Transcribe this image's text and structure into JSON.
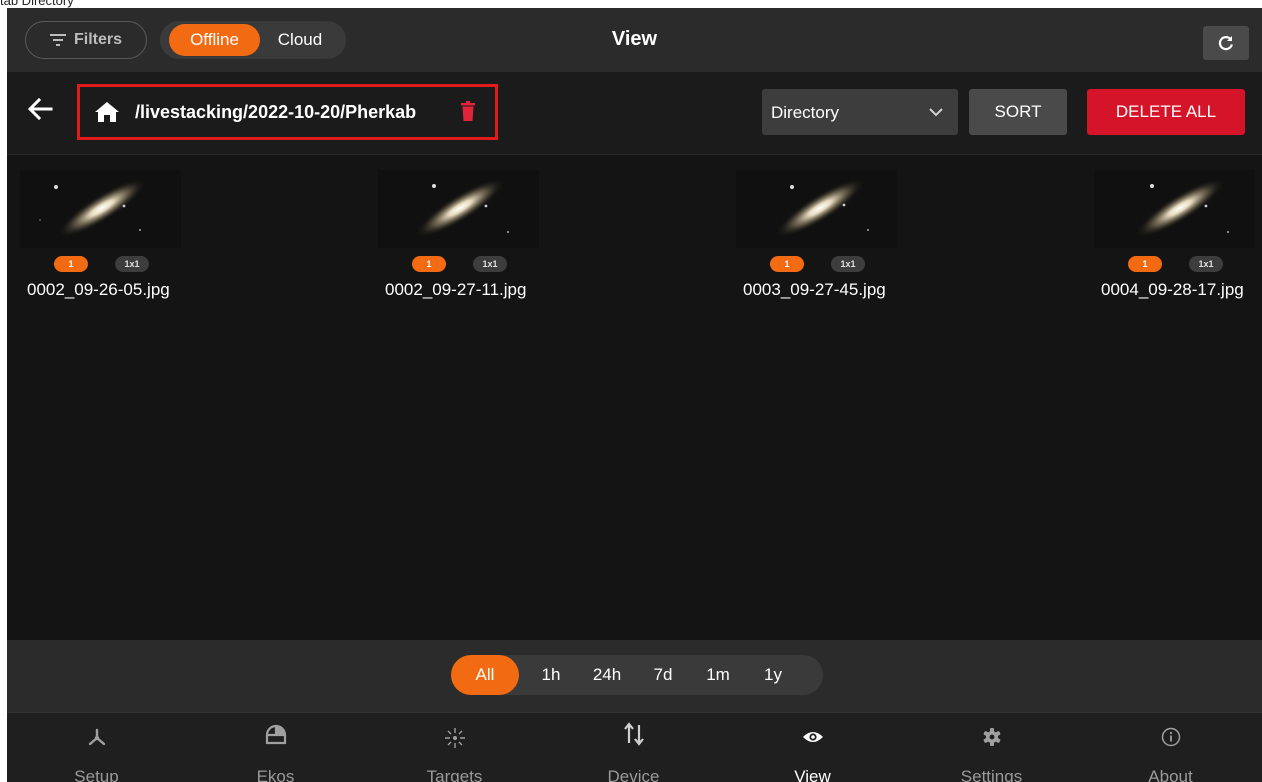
{
  "top_label": "tab Directory",
  "header": {
    "filters_label": "Filters",
    "segment": {
      "offline": "Offline",
      "cloud": "Cloud",
      "active": "Offline"
    },
    "title": "View"
  },
  "pathbar": {
    "path": "/livestacking/2022-10-20/Pherkab",
    "sort_select": "Directory",
    "sort_button": "SORT",
    "delete_all_button": "DELETE ALL"
  },
  "files": [
    {
      "name": "0002_09-26-05.jpg",
      "count": "1",
      "binning": "1x1"
    },
    {
      "name": "0002_09-27-11.jpg",
      "count": "1",
      "binning": "1x1"
    },
    {
      "name": "0003_09-27-45.jpg",
      "count": "1",
      "binning": "1x1"
    },
    {
      "name": "0004_09-28-17.jpg",
      "count": "1",
      "binning": "1x1"
    }
  ],
  "time_filters": {
    "options": [
      "All",
      "1h",
      "24h",
      "7d",
      "1m",
      "1y"
    ],
    "active": "All"
  },
  "nav": {
    "items": [
      {
        "label": "Setup",
        "icon": "setup-icon"
      },
      {
        "label": "Ekos",
        "icon": "ekos-icon"
      },
      {
        "label": "Targets",
        "icon": "targets-icon"
      },
      {
        "label": "Device",
        "icon": "device-icon"
      },
      {
        "label": "View",
        "icon": "eye-icon"
      },
      {
        "label": "Settings",
        "icon": "gear-icon"
      },
      {
        "label": "About",
        "icon": "info-icon"
      }
    ],
    "active": "View"
  },
  "colors": {
    "accent": "#f26a12",
    "danger": "#d5142a",
    "highlight_box": "#e01b1b"
  }
}
